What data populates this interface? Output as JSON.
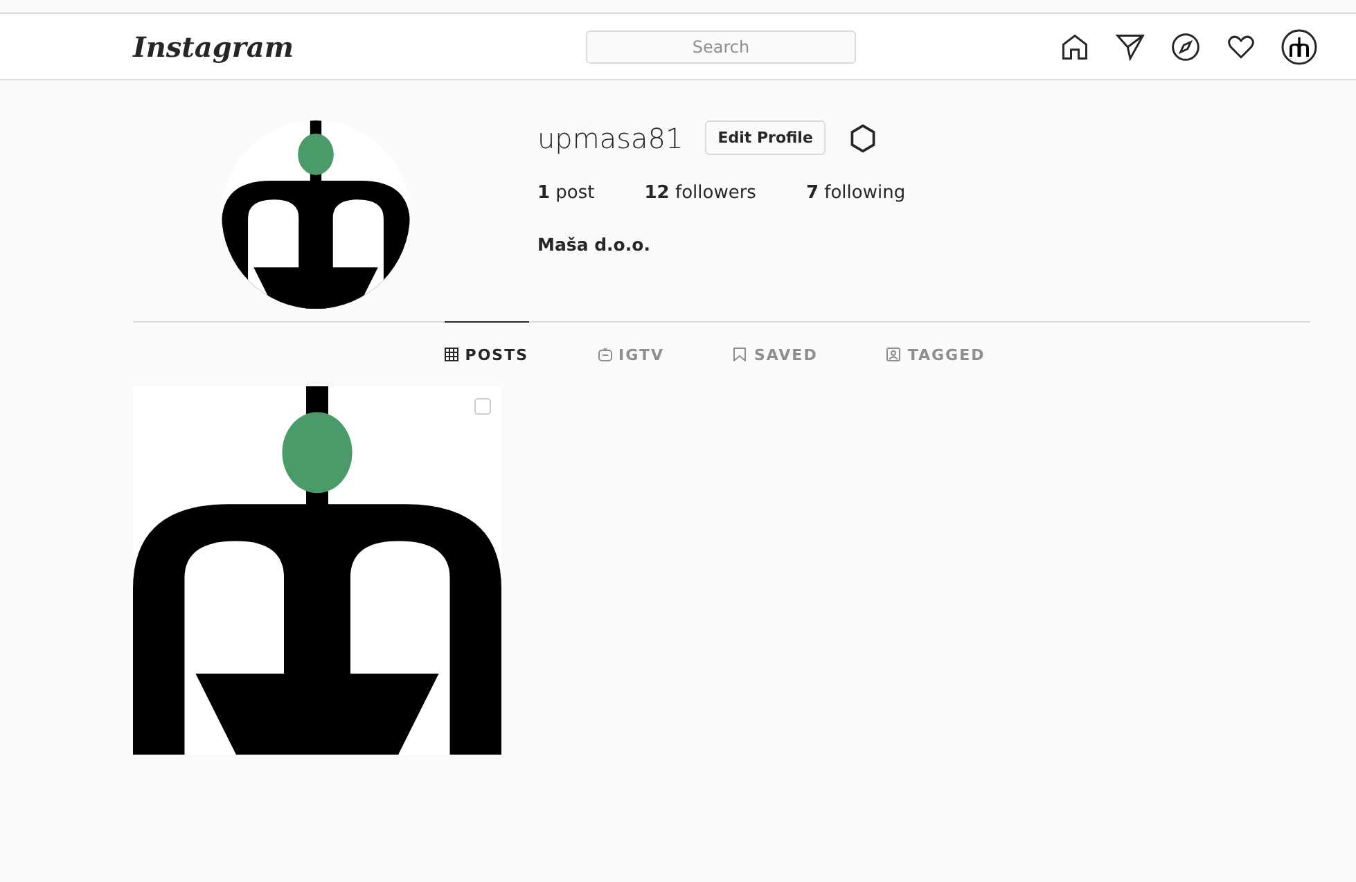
{
  "header": {
    "logo": "Instagram",
    "search": {
      "placeholder": "Search"
    }
  },
  "profile": {
    "username": "upmasa81",
    "edit_button": "Edit Profile",
    "stats": [
      "**1** post",
      "**12** followers",
      "**7** following"
    ],
    "name": "Maša d.o.o."
  },
  "tabs": [
    {
      "label": "POSTS",
      "kind": "grid",
      "selected": true
    },
    {
      "label": "IGTV",
      "kind": "tv",
      "selected": false
    },
    {
      "label": "SAVED",
      "kind": "bookmark",
      "selected": false
    },
    {
      "label": "TAGGED",
      "kind": "tag",
      "selected": false
    }
  ],
  "posts": [
    {
      "kind": "picture",
      "multiple": true
    }
  ]
}
